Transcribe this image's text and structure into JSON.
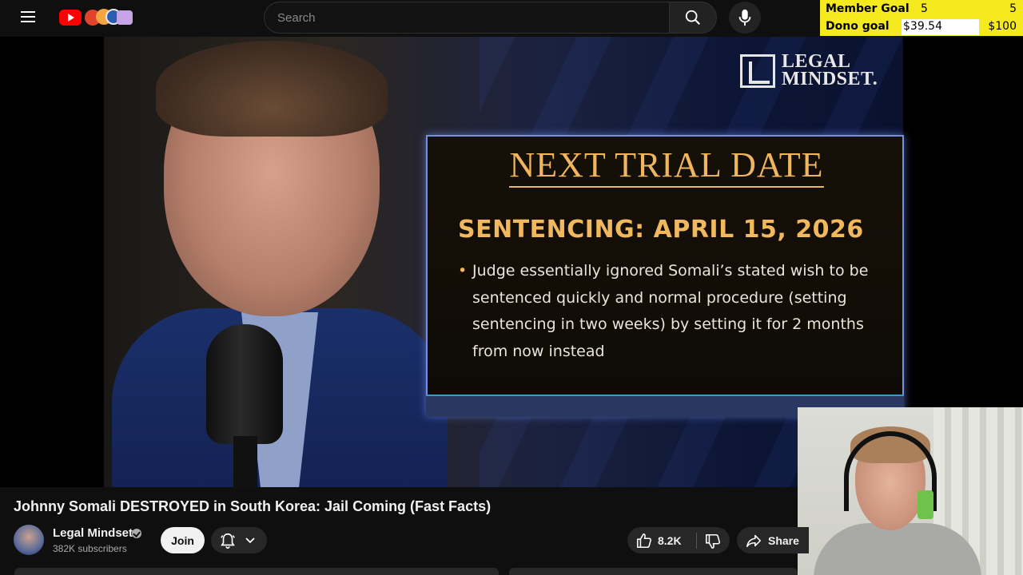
{
  "topbar": {
    "search": {
      "placeholder": "Search"
    }
  },
  "goals": {
    "member": {
      "label": "Member Goal",
      "current": "5",
      "max": "5",
      "progress_fraction": 1.0
    },
    "dono": {
      "label": "Dono goal",
      "current": "$39.54",
      "max": "$100",
      "progress_fraction": 0.3954
    },
    "colors": {
      "background": "#f5ea1e"
    }
  },
  "video": {
    "logo": {
      "line1": "LEGAL",
      "line2": "MINDSET."
    },
    "slide": {
      "title": "NEXT TRIAL DATE",
      "heading": "SENTENCING: APRIL 15, 2026",
      "bullet": "Judge essentially ignored Somali’s stated wish to be sentenced quickly and normal procedure (setting sentencing in two weeks) by setting it for 2 months from now instead"
    }
  },
  "details": {
    "title": "Johnny Somali DESTROYED in South Korea: Jail Coming (Fast Facts)",
    "channel": {
      "name": "Legal Mindset",
      "subscribers": "382K subscribers"
    },
    "join_label": "Join",
    "likes": "8.2K",
    "share_label": "Share"
  },
  "icons": [
    "menu-icon",
    "youtube-logo-icon",
    "search-icon",
    "microphone-icon",
    "bell-icon",
    "chevron-down-icon",
    "thumbs-up-icon",
    "thumbs-down-icon",
    "share-arrow-icon",
    "verified-check-icon"
  ]
}
